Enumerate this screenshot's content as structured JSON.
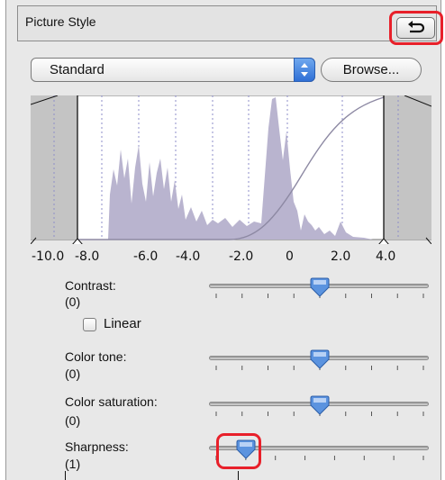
{
  "header": {
    "title": "Picture Style",
    "reset_icon": "undo-arrow-icon"
  },
  "preset": {
    "selected": "Standard",
    "browse_label": "Browse..."
  },
  "histogram": {
    "axis_labels": [
      "-10.0",
      "-8.0",
      "-6.0",
      "-4.0",
      "-2.0",
      "0",
      "2.0",
      "4.0"
    ],
    "fill_color": "#b9b4cf",
    "curve_color": "#8d89a3"
  },
  "params": {
    "contrast": {
      "label": "Contrast:",
      "value": "(0)",
      "level": 0
    },
    "linear": {
      "label": "Linear",
      "checked": false
    },
    "color_tone": {
      "label": "Color tone:",
      "value": "(0)",
      "level": 0
    },
    "color_saturation": {
      "label": "Color saturation:",
      "value": "(0)",
      "level": 0
    },
    "sharpness": {
      "label": "Sharpness:",
      "value": "(1)",
      "level": 1
    }
  },
  "colors": {
    "highlight": "#e8202a",
    "thumb": "#5b93df"
  }
}
